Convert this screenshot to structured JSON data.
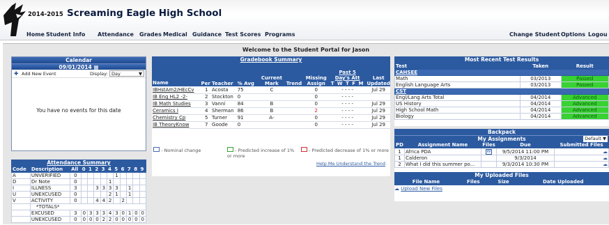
{
  "header": {
    "year": "2014-2015",
    "school": "Screaming Eagle High School"
  },
  "nav": {
    "home": "Home",
    "student_info": "Student Info",
    "attendance": "Attendance",
    "grades": "Grades",
    "medical": "Medical",
    "guidance": "Guidance",
    "test_scores": "Test Scores",
    "programs": "Programs",
    "change_student": "Change Student",
    "options": "Options",
    "logout": "Logou"
  },
  "welcome": "Welcome to the Student Portal for Jason",
  "calendar": {
    "title": "Calendar",
    "date": "09/01/2014",
    "add_event": "Add New Event",
    "display_label": "Display:",
    "display_value": "Day",
    "empty": "You have no events for this date"
  },
  "attendance": {
    "title": "Attendance Summary",
    "headers": [
      "Code",
      "Description",
      "All",
      "0",
      "1",
      "2",
      "3",
      "4",
      "5",
      "6",
      "7",
      "8",
      "9"
    ],
    "rows": [
      [
        "A",
        "UNVERIFIED",
        "0",
        "",
        "",
        "",
        "",
        "",
        "1",
        "",
        "",
        "",
        ""
      ],
      [
        "D",
        "Dr Note",
        "0",
        "",
        "",
        "",
        "",
        "1",
        "",
        "",
        "",
        "",
        ""
      ],
      [
        "I",
        "ILLNESS",
        "3",
        "",
        "",
        "3",
        "3",
        "3",
        "3",
        "",
        "1",
        "",
        ""
      ],
      [
        "U",
        "UNEXCUSED",
        "0",
        "",
        "",
        "",
        "",
        "2",
        "1",
        "",
        "1",
        "",
        ""
      ],
      [
        "V",
        "ACTIVITY",
        "0",
        "",
        "",
        "4",
        "4",
        "2",
        "",
        "2",
        "",
        "",
        ""
      ]
    ],
    "totals_label": "*TOTALS*",
    "totals": [
      [
        "",
        "EXCUSED",
        "3",
        "0",
        "3",
        "3",
        "3",
        "4",
        "3",
        "0",
        "1",
        "0",
        "0"
      ],
      [
        "",
        "UNEXCUSED",
        "0",
        "0",
        "0",
        "0",
        "2",
        "2",
        "0",
        "0",
        "0",
        "0",
        "0"
      ]
    ]
  },
  "gradebook": {
    "title": "Gradebook Summary",
    "past5": "Past 5",
    "days_att": "Day's Att",
    "days": "T W T F M",
    "headers": {
      "name": "Name",
      "per": "Per",
      "teacher": "Teacher",
      "avg": "% Avg",
      "mark": "Current Mark",
      "trend": "Trend",
      "missing": "Missing Assign",
      "updated": "Last Updated"
    },
    "rows": [
      {
        "name": "IBHstAm2/HEcCv",
        "per": "1",
        "teacher": "Acosta",
        "avg": "75",
        "mark": "C",
        "missing": "0",
        "att": "- - - -",
        "updated": "Jul 29"
      },
      {
        "name": "IB Eng HL2 -2-",
        "per": "2",
        "teacher": "Stockton",
        "avg": "0",
        "mark": "",
        "missing": "0",
        "att": "- - - -",
        "updated": ""
      },
      {
        "name": "IB Math Studies",
        "per": "3",
        "teacher": "Vanni",
        "avg": "84",
        "mark": "B",
        "missing": "0",
        "att": "- - - -",
        "updated": "Jul 29"
      },
      {
        "name": "Ceramics I",
        "per": "4",
        "teacher": "Sherman",
        "avg": "86",
        "mark": "B",
        "missing": "2",
        "att": "- - - -",
        "updated": "Jul 29"
      },
      {
        "name": "Chemistry Cp",
        "per": "5",
        "teacher": "Turner",
        "avg": "91",
        "mark": "A-",
        "missing": "0",
        "att": "- - - -",
        "updated": "Jul 29"
      },
      {
        "name": "IB TheoryKnow",
        "per": "7",
        "teacher": "Goode",
        "avg": "0",
        "mark": "",
        "missing": "0",
        "att": "- - - -",
        "updated": "Jul 29"
      }
    ],
    "legend_nominal": "- Nominal change",
    "legend_inc": "- Predicted increase of 1% or more",
    "legend_dec": "- Predicted decrease of 1% or more",
    "help": "Help Me Understand the Trend"
  },
  "tests": {
    "title": "Most Recent Test Results",
    "headers": [
      "Test",
      "Taken",
      "Result"
    ],
    "groups": [
      {
        "name": "CAHSEE",
        "rows": [
          [
            "Math",
            "03/2013",
            "Passed"
          ],
          [
            "English Language Arts",
            "03/2013",
            "Passed"
          ]
        ]
      },
      {
        "name": "CST",
        "rows": [
          [
            "Engl/Lang Arts Total",
            "04/2014",
            "Advanced"
          ],
          [
            "US History",
            "04/2014",
            "Advanced"
          ],
          [
            "High School Math",
            "04/2014",
            "Advanced"
          ],
          [
            "Biology",
            "04/2014",
            "Advanced"
          ]
        ]
      }
    ]
  },
  "backpack": {
    "title": "Backpack",
    "my_assignments": "My Assignments",
    "filter": "Default",
    "headers": [
      "PD",
      "Assignment Name",
      "Files",
      "Due",
      "Submitted Files"
    ],
    "rows": [
      [
        "1",
        "Africa PDA",
        "W",
        "9/5/2014 11:00 PM"
      ],
      [
        "1",
        "Calderon",
        "",
        "9/3/2014"
      ],
      [
        "2",
        "What I did this summer po...",
        "",
        "9/3/2014 10:30 PM"
      ]
    ],
    "uploaded_title": "My Uploaded Files",
    "uploaded_headers": [
      "File Name",
      "Files",
      "Size",
      "Date Uploaded"
    ],
    "upload_link": "Upload New Files"
  },
  "colors": {
    "header_blue": "#2c5aa0",
    "pass_green": "#38d233",
    "nav_text": "#16233f"
  }
}
